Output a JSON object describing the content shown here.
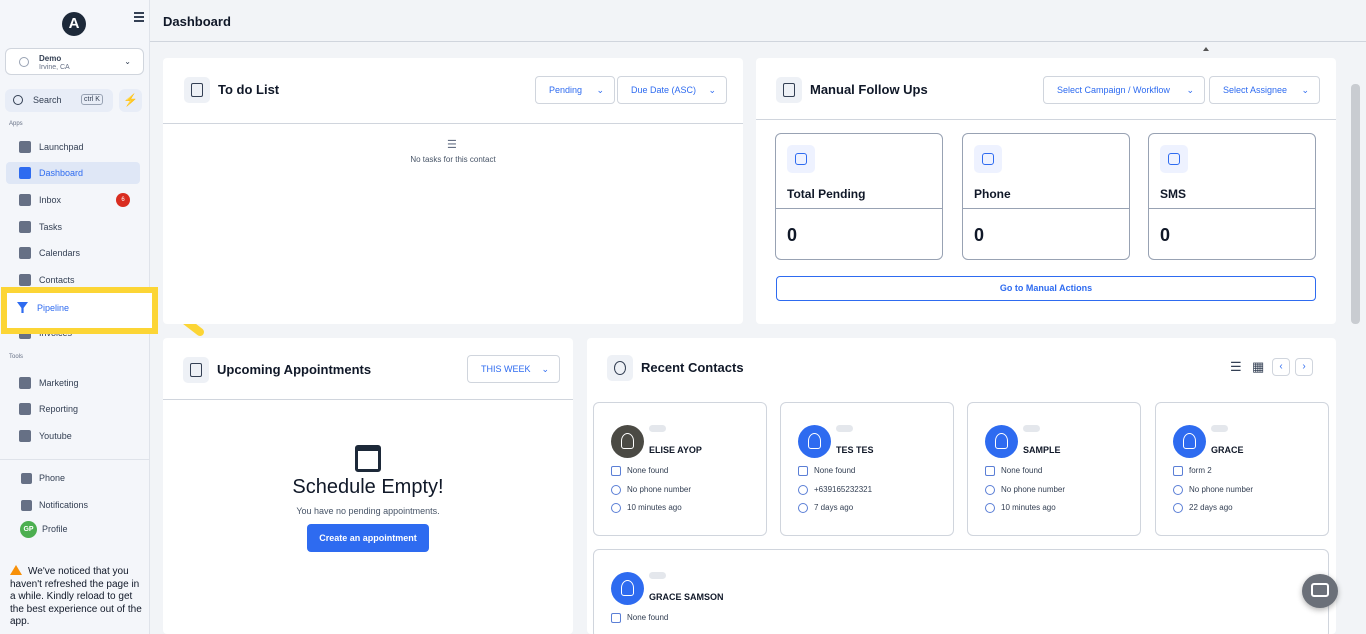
{
  "sidebar": {
    "logo": "A",
    "location": {
      "name": "Demo",
      "sub": "Irvine, CA"
    },
    "search": {
      "label": "Search",
      "shortcut": "ctrl K"
    },
    "apps_label": "Apps",
    "tools_label": "Tools",
    "items": [
      {
        "label": "Launchpad"
      },
      {
        "label": "Dashboard"
      },
      {
        "label": "Inbox",
        "badge": "6"
      },
      {
        "label": "Tasks"
      },
      {
        "label": "Calendars"
      },
      {
        "label": "Contacts"
      },
      {
        "label": "Invoices"
      },
      {
        "label": "Marketing"
      },
      {
        "label": "Reporting"
      },
      {
        "label": "Youtube"
      }
    ],
    "pipeline_label": "Pipeline",
    "phone_label": "Phone",
    "notifications_label": "Notifications",
    "profile": {
      "initials": "GP",
      "label": "Profile"
    },
    "warning": "We've noticed that you haven't refreshed the page in a while. Kindly reload to get the best experience out of the app."
  },
  "header": {
    "title": "Dashboard"
  },
  "todo": {
    "title": "To do List",
    "filter_status": "Pending",
    "filter_sort": "Due Date (ASC)",
    "empty_text": "No tasks for this contact"
  },
  "followups": {
    "title": "Manual Follow Ups",
    "campaign_placeholder": "Select Campaign / Workflow",
    "assignee_placeholder": "Select Assignee",
    "stats": [
      {
        "label": "Total Pending",
        "value": "0"
      },
      {
        "label": "Phone",
        "value": "0"
      },
      {
        "label": "SMS",
        "value": "0"
      }
    ],
    "action_label": "Go to Manual Actions"
  },
  "appointments": {
    "title": "Upcoming Appointments",
    "range": "THIS WEEK",
    "empty_title": "Schedule Empty!",
    "empty_sub": "You have no pending appointments.",
    "create_label": "Create an appointment"
  },
  "recent_contacts": {
    "title": "Recent Contacts",
    "contacts": [
      {
        "name": "ELISE AYOP",
        "source": "None found",
        "phone": "No phone number",
        "time": "10 minutes ago"
      },
      {
        "name": "TES TES",
        "source": "None found",
        "phone": "+639165232321",
        "time": "7 days ago"
      },
      {
        "name": "SAMPLE",
        "source": "None found",
        "phone": "No phone number",
        "time": "10 minutes ago"
      },
      {
        "name": "GRACE",
        "source": "form 2",
        "phone": "No phone number",
        "time": "22 days ago"
      },
      {
        "name": "GRACE SAMSON",
        "source": "None found"
      }
    ]
  },
  "colors": {
    "accent": "#2e6bf0",
    "highlight": "#fcd535",
    "badge": "#d92d20"
  }
}
